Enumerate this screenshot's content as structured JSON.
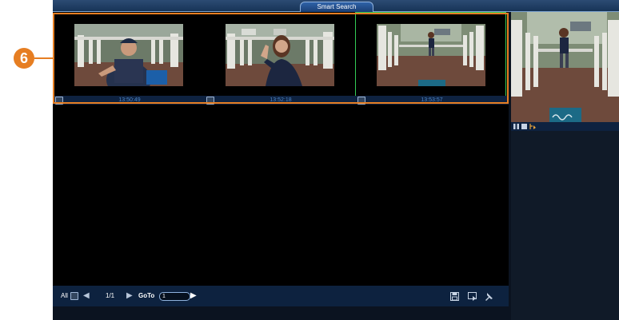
{
  "window": {
    "title": "Smart Search"
  },
  "callout": {
    "label": "6"
  },
  "results": [
    {
      "time": "13:50:49",
      "scene": "delivery-man-photo"
    },
    {
      "time": "13:52:18",
      "scene": "woman-waving-photo"
    },
    {
      "time": "13:53:57",
      "scene": "woman-walking-photo",
      "selected": true
    }
  ],
  "footer": {
    "all_label": "All",
    "page_indicator": "1/1",
    "goto_label": "GoTo",
    "goto_value": "1",
    "icons": [
      "save-icon",
      "export-icon",
      "pin-icon"
    ]
  },
  "preview": {
    "scene": "woman-walking-photo",
    "controls": [
      "pause-icon",
      "stop-icon",
      "marker-icon"
    ]
  },
  "colors": {
    "accent": "#e67e22",
    "selection": "#33cc55",
    "timestamp": "#4f86c6",
    "bar": "#0d223f"
  }
}
